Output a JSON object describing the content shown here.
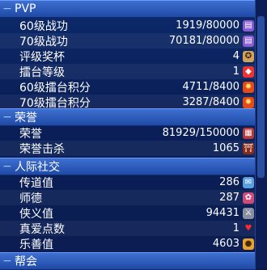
{
  "sections": [
    {
      "title": "PVP",
      "expander": "−"
    },
    {
      "title": "荣誉",
      "expander": "−"
    },
    {
      "title": "人际社交",
      "expander": "−"
    },
    {
      "title": "帮会",
      "expander": "−"
    }
  ],
  "pvp_rows": [
    {
      "label": "60级战功",
      "value": "1919/80000",
      "icon": "scroll-icon"
    },
    {
      "label": "70级战功",
      "value": "70181/80000",
      "icon": "scroll-icon"
    },
    {
      "label": "评级奖杯",
      "value": "4",
      "icon": "medal-icon"
    },
    {
      "label": "擂台等级",
      "value": "1",
      "icon": "rank-badge-icon"
    },
    {
      "label": "60级擂台积分",
      "value": "4711/8400",
      "icon": "fire-emblem-icon"
    },
    {
      "label": "70级擂台积分",
      "value": "3287/8400",
      "icon": "fire-emblem-icon"
    }
  ],
  "honor_rows": [
    {
      "label": "荣誉",
      "value": "81929/150000",
      "icon": "book-icon"
    },
    {
      "label": "荣誉击杀",
      "value": "1065",
      "icon": "gate-icon"
    }
  ],
  "social_rows": [
    {
      "label": "传道值",
      "value": "286",
      "icon": "chat-icon"
    },
    {
      "label": "师德",
      "value": "287",
      "icon": "flower-icon"
    },
    {
      "label": "侠义值",
      "value": "94431",
      "icon": "sword-icon"
    },
    {
      "label": "真爱点数",
      "value": "1",
      "icon": "heart-icon"
    },
    {
      "label": "乐善值",
      "value": "4603",
      "icon": "money-bag-icon"
    }
  ],
  "colors": {
    "accent": "#3e6fd0",
    "background": "#0a1f58"
  }
}
